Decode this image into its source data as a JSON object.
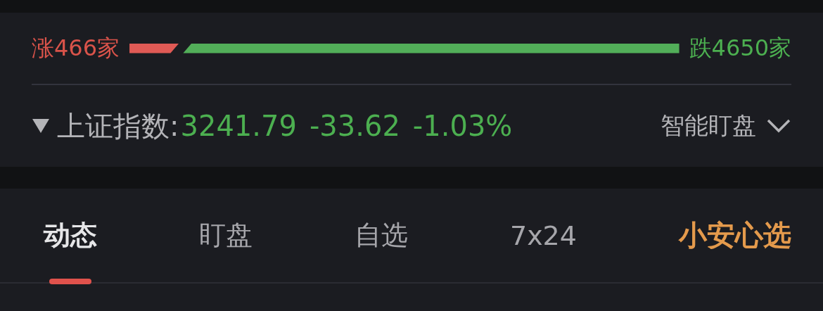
{
  "breadth": {
    "up_label": "涨466家",
    "down_label": "跌4650家"
  },
  "index": {
    "expanded": false,
    "name": "上证指数:",
    "price": "3241.79",
    "change": "-33.62",
    "percent": "-1.03%",
    "monitor_label": "智能盯盘"
  },
  "tabs": [
    {
      "label": "动态",
      "selected": true,
      "kind": "text"
    },
    {
      "label": "盯盘",
      "selected": false,
      "kind": "text"
    },
    {
      "label": "自选",
      "selected": false,
      "kind": "text"
    },
    {
      "label": "7x24",
      "selected": false,
      "kind": "text"
    },
    {
      "label": "小安心选",
      "selected": false,
      "kind": "brand"
    }
  ]
}
